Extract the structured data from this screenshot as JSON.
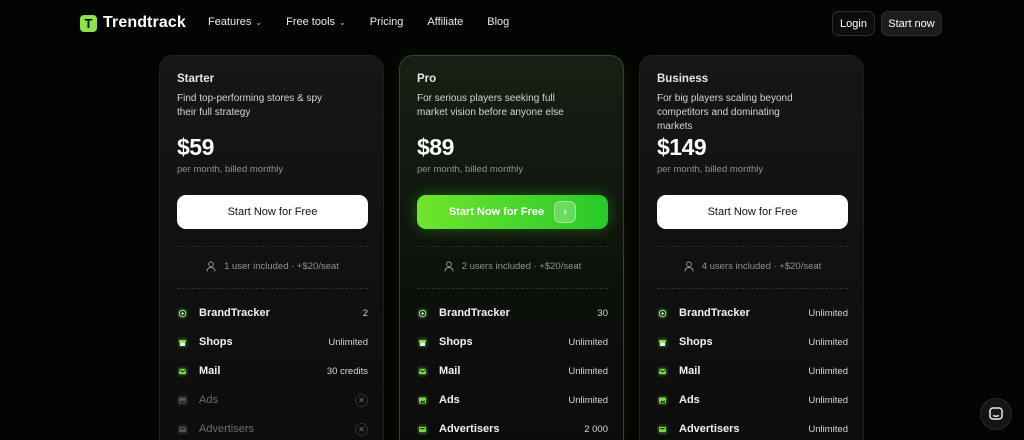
{
  "nav": {
    "brand": "Trendtrack",
    "logo_glyph": "T",
    "menu": [
      {
        "label": "Features",
        "dropdown": true
      },
      {
        "label": "Free tools",
        "dropdown": true
      },
      {
        "label": "Pricing",
        "dropdown": false
      },
      {
        "label": "Affiliate",
        "dropdown": false
      },
      {
        "label": "Blog",
        "dropdown": false
      }
    ],
    "login": "Login",
    "start": "Start now"
  },
  "colors": {
    "accent": "#8ee34a",
    "cta_gradient_start": "#6fe62d",
    "cta_gradient_end": "#28c92a",
    "background": "#020402"
  },
  "plans": [
    {
      "name": "Starter",
      "description": "Find top-performing stores & spy their full strategy",
      "price": "$59",
      "billing": "per month, billed monthly",
      "cta": "Start Now for Free",
      "seats": "1 user included · +$20/seat",
      "features": [
        {
          "name": "BrandTracker",
          "value": "2",
          "icon": "crosshair-icon",
          "included": true
        },
        {
          "name": "Shops",
          "value": "Unlimited",
          "icon": "store-icon",
          "included": true
        },
        {
          "name": "Mail",
          "value": "30 credits",
          "icon": "mail-icon",
          "included": true
        },
        {
          "name": "Ads",
          "value": "",
          "icon": "image-icon",
          "included": false
        },
        {
          "name": "Advertisers",
          "value": "",
          "icon": "advertiser-icon",
          "included": false
        }
      ]
    },
    {
      "name": "Pro",
      "description": "For serious players seeking full market vision before anyone else",
      "price": "$89",
      "billing": "per month, billed monthly",
      "cta": "Start Now for Free",
      "seats": "2 users included · +$20/seat",
      "features": [
        {
          "name": "BrandTracker",
          "value": "30",
          "icon": "crosshair-icon",
          "included": true
        },
        {
          "name": "Shops",
          "value": "Unlimited",
          "icon": "store-icon",
          "included": true
        },
        {
          "name": "Mail",
          "value": "Unlimited",
          "icon": "mail-icon",
          "included": true
        },
        {
          "name": "Ads",
          "value": "Unlimited",
          "icon": "image-icon",
          "included": true
        },
        {
          "name": "Advertisers",
          "value": "2 000",
          "icon": "advertiser-icon",
          "included": true
        }
      ]
    },
    {
      "name": "Business",
      "description": "For big players scaling beyond competitors and dominating markets",
      "price": "$149",
      "billing": "per month, billed monthly",
      "cta": "Start Now for Free",
      "seats": "4 users included · +$20/seat",
      "features": [
        {
          "name": "BrandTracker",
          "value": "Unlimited",
          "icon": "crosshair-icon",
          "included": true
        },
        {
          "name": "Shops",
          "value": "Unlimited",
          "icon": "store-icon",
          "included": true
        },
        {
          "name": "Mail",
          "value": "Unlimited",
          "icon": "mail-icon",
          "included": true
        },
        {
          "name": "Ads",
          "value": "Unlimited",
          "icon": "image-icon",
          "included": true
        },
        {
          "name": "Advertisers",
          "value": "Unlimited",
          "icon": "advertiser-icon",
          "included": true
        }
      ]
    }
  ]
}
